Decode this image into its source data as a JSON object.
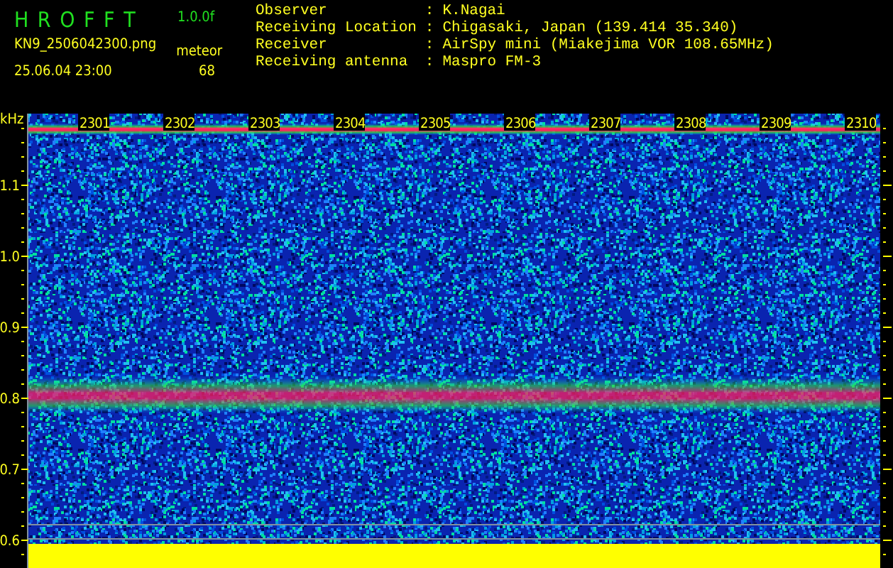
{
  "header": {
    "title": "H R O F F T",
    "version": "1.0.0f",
    "filename": "KN9_2506042300.png",
    "datetime": "25.06.04 23:00",
    "mode": "meteor",
    "count": "68"
  },
  "info": [
    {
      "label": "Observer",
      "value": "K.Nagai"
    },
    {
      "label": "Receiving Location",
      "value": "Chigasaki, Japan (139.414 35.340)"
    },
    {
      "label": "Receiver",
      "value": "AirSpy mini (Miakejima VOR 108.65MHz)"
    },
    {
      "label": "Receiving antenna",
      "value": "Maspro FM-3"
    }
  ],
  "separator": ":",
  "spectrogram": {
    "unit": "kHz",
    "y_labels": [
      "1.1",
      "1.0",
      "0.9",
      "0.8",
      "0.7",
      "0.6"
    ],
    "time_labels": [
      "2301",
      "2302",
      "2303",
      "2304",
      "2305",
      "2306",
      "2307",
      "2308",
      "2309",
      "2310"
    ]
  }
}
